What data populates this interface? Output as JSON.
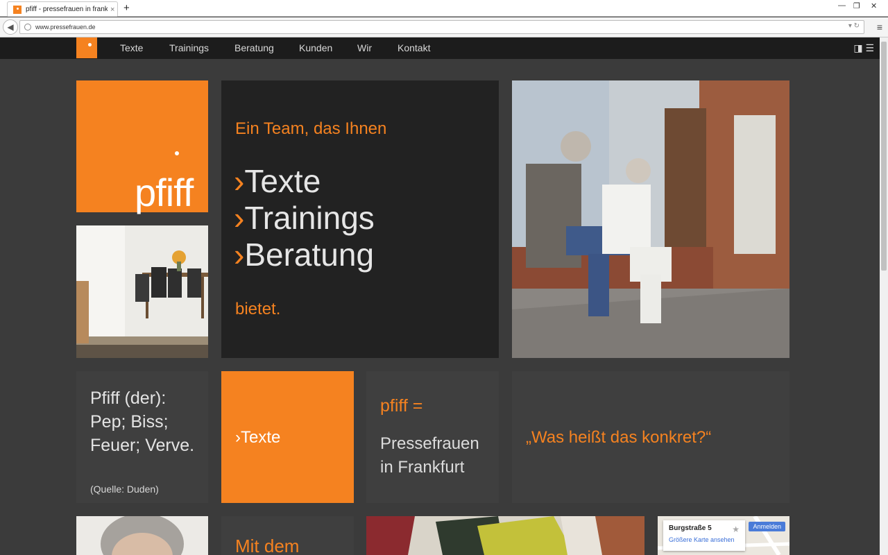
{
  "browser": {
    "tab_title": "pfiff - pressefrauen in frank...",
    "tab_close": "×",
    "new_tab": "+",
    "url": "www.pressefrauen.de",
    "win_min": "—",
    "win_restore": "❐",
    "win_close": "✕"
  },
  "nav": {
    "items": [
      "Texte",
      "Trainings",
      "Beratung",
      "Kunden",
      "Wir",
      "Kontakt"
    ]
  },
  "hero": {
    "logo_text": "pfiff",
    "heading": "Ein Team, das Ihnen",
    "services": [
      "›Texte",
      "›Trainings",
      "›Beratung"
    ],
    "closing": "bietet."
  },
  "row2": {
    "duden_lines": [
      "Pfiff (der):",
      "Pep; Biss;",
      "Feuer; Verve."
    ],
    "duden_source": "(Quelle: Duden)",
    "texte_link": "›Texte",
    "pfiff_eq": "pfiff =",
    "pf_lines": [
      "Pressefrauen",
      "in Frankfurt"
    ],
    "quote": "„Was heißt das konkret?“"
  },
  "row3": {
    "mit_heading": "Mit dem",
    "map_street": "Burgstraße 5",
    "map_link": "Größere Karte ansehen",
    "map_login": "Anmelden",
    "map_star": "★"
  },
  "colors": {
    "accent": "#f58220",
    "dark_tile": "#222222",
    "page_bg": "#3b3b3b"
  }
}
